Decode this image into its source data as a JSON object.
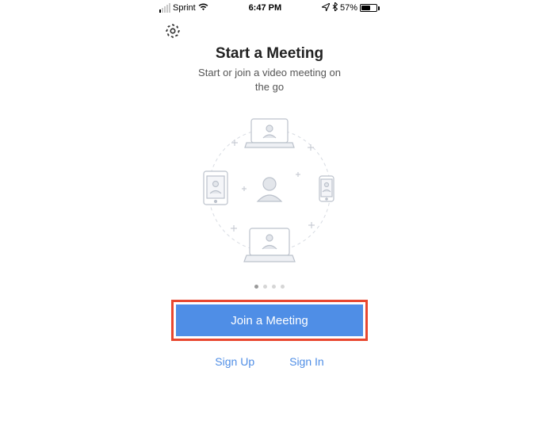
{
  "status": {
    "carrier": "Sprint",
    "time": "6:47 PM",
    "battery_pct": "57%"
  },
  "header": {
    "title": "Start a Meeting",
    "subtitle_line1": "Start or join a video meeting on",
    "subtitle_line2": "the go"
  },
  "pager": {
    "count": 4,
    "active": 0
  },
  "actions": {
    "join_label": "Join a Meeting",
    "signup_label": "Sign Up",
    "signin_label": "Sign In"
  },
  "highlight": {
    "color": "#e8472f"
  }
}
